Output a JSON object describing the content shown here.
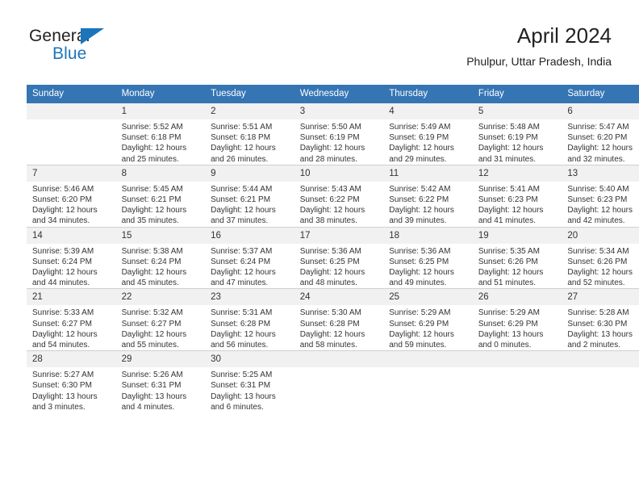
{
  "logo": {
    "word_dark": "General",
    "word_blue": "Blue",
    "triangle_color": "#1b75bb"
  },
  "header": {
    "title": "April 2024",
    "subtitle": "Phulpur, Uttar Pradesh, India"
  },
  "theme": {
    "header_blue": "#3575b4",
    "daynum_band": "#f1f1f1",
    "text": "#333333"
  },
  "weekday_headers": [
    "Sunday",
    "Monday",
    "Tuesday",
    "Wednesday",
    "Thursday",
    "Friday",
    "Saturday"
  ],
  "weeks": [
    [
      {
        "day": "",
        "lines": []
      },
      {
        "day": "1",
        "lines": [
          "Sunrise: 5:52 AM",
          "Sunset: 6:18 PM",
          "Daylight: 12 hours",
          "and 25 minutes."
        ]
      },
      {
        "day": "2",
        "lines": [
          "Sunrise: 5:51 AM",
          "Sunset: 6:18 PM",
          "Daylight: 12 hours",
          "and 26 minutes."
        ]
      },
      {
        "day": "3",
        "lines": [
          "Sunrise: 5:50 AM",
          "Sunset: 6:19 PM",
          "Daylight: 12 hours",
          "and 28 minutes."
        ]
      },
      {
        "day": "4",
        "lines": [
          "Sunrise: 5:49 AM",
          "Sunset: 6:19 PM",
          "Daylight: 12 hours",
          "and 29 minutes."
        ]
      },
      {
        "day": "5",
        "lines": [
          "Sunrise: 5:48 AM",
          "Sunset: 6:19 PM",
          "Daylight: 12 hours",
          "and 31 minutes."
        ]
      },
      {
        "day": "6",
        "lines": [
          "Sunrise: 5:47 AM",
          "Sunset: 6:20 PM",
          "Daylight: 12 hours",
          "and 32 minutes."
        ]
      }
    ],
    [
      {
        "day": "7",
        "lines": [
          "Sunrise: 5:46 AM",
          "Sunset: 6:20 PM",
          "Daylight: 12 hours",
          "and 34 minutes."
        ]
      },
      {
        "day": "8",
        "lines": [
          "Sunrise: 5:45 AM",
          "Sunset: 6:21 PM",
          "Daylight: 12 hours",
          "and 35 minutes."
        ]
      },
      {
        "day": "9",
        "lines": [
          "Sunrise: 5:44 AM",
          "Sunset: 6:21 PM",
          "Daylight: 12 hours",
          "and 37 minutes."
        ]
      },
      {
        "day": "10",
        "lines": [
          "Sunrise: 5:43 AM",
          "Sunset: 6:22 PM",
          "Daylight: 12 hours",
          "and 38 minutes."
        ]
      },
      {
        "day": "11",
        "lines": [
          "Sunrise: 5:42 AM",
          "Sunset: 6:22 PM",
          "Daylight: 12 hours",
          "and 39 minutes."
        ]
      },
      {
        "day": "12",
        "lines": [
          "Sunrise: 5:41 AM",
          "Sunset: 6:23 PM",
          "Daylight: 12 hours",
          "and 41 minutes."
        ]
      },
      {
        "day": "13",
        "lines": [
          "Sunrise: 5:40 AM",
          "Sunset: 6:23 PM",
          "Daylight: 12 hours",
          "and 42 minutes."
        ]
      }
    ],
    [
      {
        "day": "14",
        "lines": [
          "Sunrise: 5:39 AM",
          "Sunset: 6:24 PM",
          "Daylight: 12 hours",
          "and 44 minutes."
        ]
      },
      {
        "day": "15",
        "lines": [
          "Sunrise: 5:38 AM",
          "Sunset: 6:24 PM",
          "Daylight: 12 hours",
          "and 45 minutes."
        ]
      },
      {
        "day": "16",
        "lines": [
          "Sunrise: 5:37 AM",
          "Sunset: 6:24 PM",
          "Daylight: 12 hours",
          "and 47 minutes."
        ]
      },
      {
        "day": "17",
        "lines": [
          "Sunrise: 5:36 AM",
          "Sunset: 6:25 PM",
          "Daylight: 12 hours",
          "and 48 minutes."
        ]
      },
      {
        "day": "18",
        "lines": [
          "Sunrise: 5:36 AM",
          "Sunset: 6:25 PM",
          "Daylight: 12 hours",
          "and 49 minutes."
        ]
      },
      {
        "day": "19",
        "lines": [
          "Sunrise: 5:35 AM",
          "Sunset: 6:26 PM",
          "Daylight: 12 hours",
          "and 51 minutes."
        ]
      },
      {
        "day": "20",
        "lines": [
          "Sunrise: 5:34 AM",
          "Sunset: 6:26 PM",
          "Daylight: 12 hours",
          "and 52 minutes."
        ]
      }
    ],
    [
      {
        "day": "21",
        "lines": [
          "Sunrise: 5:33 AM",
          "Sunset: 6:27 PM",
          "Daylight: 12 hours",
          "and 54 minutes."
        ]
      },
      {
        "day": "22",
        "lines": [
          "Sunrise: 5:32 AM",
          "Sunset: 6:27 PM",
          "Daylight: 12 hours",
          "and 55 minutes."
        ]
      },
      {
        "day": "23",
        "lines": [
          "Sunrise: 5:31 AM",
          "Sunset: 6:28 PM",
          "Daylight: 12 hours",
          "and 56 minutes."
        ]
      },
      {
        "day": "24",
        "lines": [
          "Sunrise: 5:30 AM",
          "Sunset: 6:28 PM",
          "Daylight: 12 hours",
          "and 58 minutes."
        ]
      },
      {
        "day": "25",
        "lines": [
          "Sunrise: 5:29 AM",
          "Sunset: 6:29 PM",
          "Daylight: 12 hours",
          "and 59 minutes."
        ]
      },
      {
        "day": "26",
        "lines": [
          "Sunrise: 5:29 AM",
          "Sunset: 6:29 PM",
          "Daylight: 13 hours",
          "and 0 minutes."
        ]
      },
      {
        "day": "27",
        "lines": [
          "Sunrise: 5:28 AM",
          "Sunset: 6:30 PM",
          "Daylight: 13 hours",
          "and 2 minutes."
        ]
      }
    ],
    [
      {
        "day": "28",
        "lines": [
          "Sunrise: 5:27 AM",
          "Sunset: 6:30 PM",
          "Daylight: 13 hours",
          "and 3 minutes."
        ]
      },
      {
        "day": "29",
        "lines": [
          "Sunrise: 5:26 AM",
          "Sunset: 6:31 PM",
          "Daylight: 13 hours",
          "and 4 minutes."
        ]
      },
      {
        "day": "30",
        "lines": [
          "Sunrise: 5:25 AM",
          "Sunset: 6:31 PM",
          "Daylight: 13 hours",
          "and 6 minutes."
        ]
      },
      {
        "day": "",
        "lines": []
      },
      {
        "day": "",
        "lines": []
      },
      {
        "day": "",
        "lines": []
      },
      {
        "day": "",
        "lines": []
      }
    ]
  ]
}
